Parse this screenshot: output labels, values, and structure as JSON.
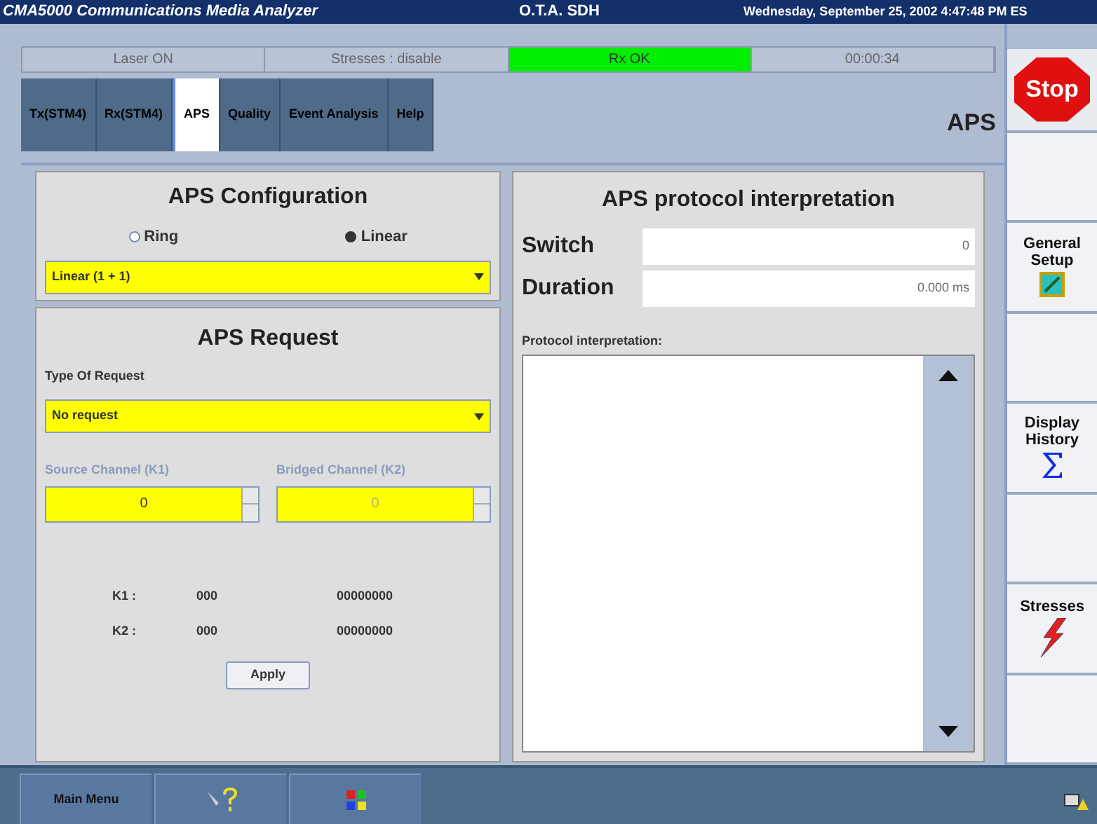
{
  "title_bar": {
    "app": "CMA5000 Communications Media Analyzer",
    "mode": "O.T.A. SDH",
    "datetime": "Wednesday, September 25, 2002 4:47:48 PM ES"
  },
  "status_bar": [
    {
      "text": "Laser ON",
      "kind": "plain"
    },
    {
      "text": "Stresses : disable",
      "kind": "plain"
    },
    {
      "text": "Rx OK",
      "kind": "ok"
    },
    {
      "text": "00:00:34",
      "kind": "plain"
    }
  ],
  "tabs": [
    {
      "label": "Tx(STM4)",
      "selected": false
    },
    {
      "label": "Rx(STM4)",
      "selected": false
    },
    {
      "label": "APS",
      "selected": true
    },
    {
      "label": "Quality",
      "selected": false
    },
    {
      "label": "Event Analysis",
      "selected": false
    },
    {
      "label": "Help",
      "selected": false
    }
  ],
  "page_title": "APS",
  "aps_configuration": {
    "title": "APS Configuration",
    "options": [
      {
        "label": "Ring",
        "selected": false
      },
      {
        "label": "Linear",
        "selected": true
      }
    ],
    "dropdown": "Linear (1 + 1)"
  },
  "aps_request": {
    "title": "APS Request",
    "type_label": "Type Of Request",
    "type_value": "No request",
    "channels": [
      {
        "label": "Source Channel (K1)",
        "value": "0",
        "disabled": false
      },
      {
        "label": "Bridged Channel (K2)",
        "value": "0",
        "disabled": true
      }
    ],
    "bytes": [
      {
        "label": "K1 :",
        "code": "000",
        "bits": "00000000"
      },
      {
        "label": "K2 :",
        "code": "000",
        "bits": "00000000"
      }
    ],
    "apply": "Apply"
  },
  "protocol": {
    "title": "APS protocol interpretation",
    "fields": [
      {
        "label": "Switch",
        "value": "0"
      },
      {
        "label": "Duration",
        "value": "0.000 ms"
      }
    ],
    "interpretation_label": "Protocol interpretation:"
  },
  "side_buttons": [
    {
      "kind": "stop",
      "label": "Stop"
    },
    {
      "kind": "blank"
    },
    {
      "kind": "setup",
      "label": "General Setup"
    },
    {
      "kind": "blank"
    },
    {
      "kind": "history",
      "label": "Display History"
    },
    {
      "kind": "blank"
    },
    {
      "kind": "stresses",
      "label": "Stresses"
    },
    {
      "kind": "blank"
    }
  ],
  "taskbar": [
    {
      "kind": "text",
      "label": "Main Menu"
    },
    {
      "kind": "help"
    },
    {
      "kind": "windows"
    }
  ]
}
